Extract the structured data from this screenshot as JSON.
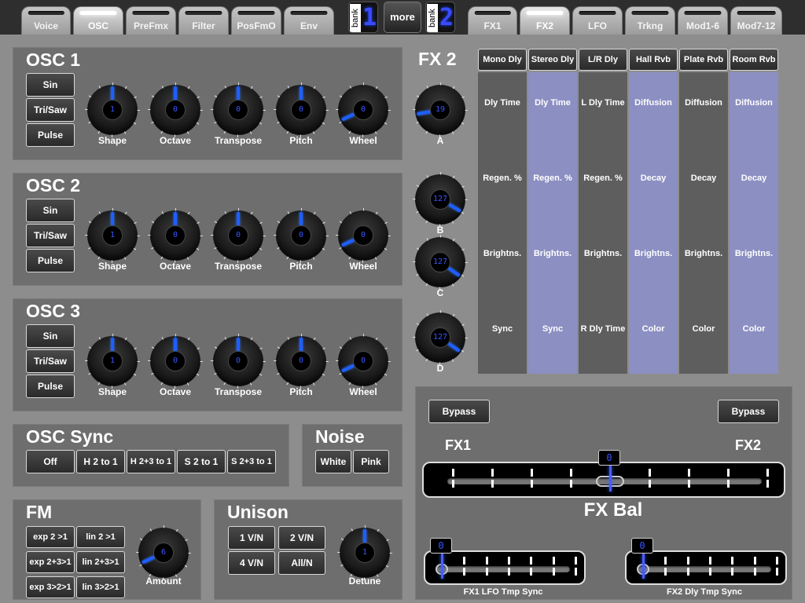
{
  "tabs_left": [
    "Voice",
    "OSC",
    "PreFmx",
    "Filter",
    "PosFmO",
    "Env"
  ],
  "tabs_right": [
    "FX1",
    "FX2",
    "LFO",
    "Trkng",
    "Mod1-6",
    "Mod7-12"
  ],
  "bank1": {
    "label": "bank",
    "value": "1"
  },
  "bank2": {
    "label": "bank",
    "value": "2"
  },
  "more_label": "more",
  "osc1": {
    "title": "OSC 1",
    "waves": [
      "Sin",
      "Tri/Saw",
      "Pulse"
    ],
    "knob_labels": [
      "Shape",
      "Octave",
      "Transpose",
      "Pitch",
      "Wheel"
    ],
    "knob_values": [
      "1",
      "0",
      "0",
      "0",
      "0"
    ]
  },
  "osc2": {
    "title": "OSC 2",
    "waves": [
      "Sin",
      "Tri/Saw",
      "Pulse"
    ],
    "knob_labels": [
      "Shape",
      "Octave",
      "Transpose",
      "Pitch",
      "Wheel"
    ],
    "knob_values": [
      "1",
      "0",
      "0",
      "0",
      "0"
    ]
  },
  "osc3": {
    "title": "OSC 3",
    "waves": [
      "Sin",
      "Tri/Saw",
      "Pulse"
    ],
    "knob_labels": [
      "Shape",
      "Octave",
      "Transpose",
      "Pitch",
      "Wheel"
    ],
    "knob_values": [
      "1",
      "0",
      "0",
      "0",
      "0"
    ]
  },
  "osc_sync": {
    "title": "OSC Sync",
    "buttons": [
      "Off",
      "H 2 to 1",
      "H 2+3 to 1",
      "S 2 to 1",
      "S 2+3 to 1"
    ]
  },
  "noise": {
    "title": "Noise",
    "buttons": [
      "White",
      "Pink"
    ]
  },
  "fm": {
    "title": "FM",
    "buttons": [
      "exp 2 >1",
      "lin 2 >1",
      "exp 2+3>1",
      "lin 2+3>1",
      "exp 3>2>1",
      "lin 3>2>1"
    ],
    "knob_label": "Amount",
    "knob_value": "6"
  },
  "unison": {
    "title": "Unison",
    "buttons": [
      "1 V/N",
      "2 V/N",
      "4 V/N",
      "All/N"
    ],
    "knob_label": "Detune",
    "knob_value": "1"
  },
  "fx2": {
    "title": "FX 2",
    "knobs": [
      {
        "label": "A",
        "value": "19"
      },
      {
        "label": "B",
        "value": "127"
      },
      {
        "label": "C",
        "value": "127"
      },
      {
        "label": "D",
        "value": "127"
      }
    ],
    "columns": [
      {
        "header": "Mono Dly",
        "rows": [
          "Dly Time",
          "Regen. %",
          "Brightns.",
          "Sync"
        ]
      },
      {
        "header": "Stereo Dly",
        "rows": [
          "Dly Time",
          "Regen. %",
          "Brightns.",
          "Sync"
        ]
      },
      {
        "header": "L/R Dly",
        "rows": [
          "L Dly Time",
          "Regen. %",
          "Brightns.",
          "R Dly Time"
        ]
      },
      {
        "header": "Hall Rvb",
        "rows": [
          "Diffusion",
          "Decay",
          "Brightns.",
          "Color"
        ]
      },
      {
        "header": "Plate Rvb",
        "rows": [
          "Diffusion",
          "Decay",
          "Brightns.",
          "Color"
        ]
      },
      {
        "header": "Room Rvb",
        "rows": [
          "Diffusion",
          "Decay",
          "Brightns.",
          "Color"
        ]
      }
    ]
  },
  "fxbal": {
    "bypass1": "Bypass",
    "bypass2": "Bypass",
    "left_label": "FX1",
    "right_label": "FX2",
    "title": "FX Bal",
    "value": "0",
    "level": 0.5
  },
  "fx1_lfo": {
    "label": "FX1 LFO Tmp Sync",
    "value": "0",
    "level": 0
  },
  "fx2_dly": {
    "label": "FX2 Dly Tmp Sync",
    "value": "0",
    "level": 0
  },
  "colors": {
    "accent": "#3b56ff",
    "panel": "#6e6e6e",
    "lite_column": "#8c8fc2"
  }
}
